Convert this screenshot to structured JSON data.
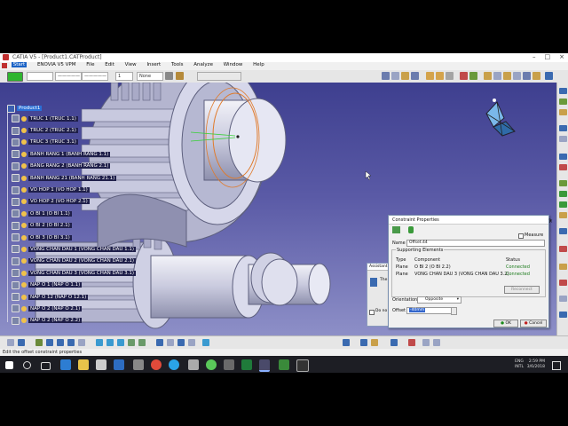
{
  "window": {
    "title": "CATIA V5 - [Product1.CATProduct]",
    "controls": [
      "–",
      "□",
      "×"
    ]
  },
  "menu": {
    "start": "Start",
    "items": [
      "ENOVIA V5 VPM",
      "File",
      "Edit",
      "View",
      "Insert",
      "Tools",
      "Analyze",
      "Window",
      "Help"
    ]
  },
  "toolbar": {
    "field_none": "None",
    "field_line": "—————",
    "field_pts": "1"
  },
  "tree": {
    "root": "Product1",
    "items": [
      "TRUC 1 (TRUC 1.1)",
      "TRUC 2 (TRUC 2.1)",
      "TRUC 3 (TRUC 3.1)",
      "BANH RANG 1 (BANH RANG 1.1)",
      "BANG RANG 2 (BANH RANG 2.1)",
      "BANH RANG 21 (BANH RANG 21.1)",
      "VO HOP 1 (VO HOP 1.1)",
      "VO HOP 2 (VO HOP 2.1)",
      "O BI 1 (O BI 1.1)",
      "O BI 2 (O BI 2.1)",
      "O BI 3 (O BI 3.1)",
      "VONG CHAN DAU 1 (VONG CHAN DAU 1.1)",
      "VONG CHAN DAU 2 (VONG CHAN DAU 2.1)",
      "VONG CHAN DAU 3 (VONG CHAN DAU 3.1)",
      "NAP O 1 (NAP O 1.1)",
      "NAP O 12 (NAP O 12.1)",
      "NAP O 2 (NAP O 2.1)",
      "NAP O 2 (NAP O 2.2)"
    ]
  },
  "dialog": {
    "title": "Constraint Properties",
    "help": "?",
    "close": "×",
    "name_label": "Name",
    "name_value": "Offset.44",
    "measure_label": "Measure",
    "group_title": "Supporting Elements",
    "columns": [
      "Type",
      "Component",
      "Status"
    ],
    "rows": [
      {
        "type": "Plane",
        "component": "O BI 2 (O BI 2.2)",
        "status": "Connected"
      },
      {
        "type": "Plane",
        "component": "VONG CHAN DAU 3 (VONG CHAN DAU 3.2)",
        "status": "Connected"
      }
    ],
    "reconnect": "Reconnect",
    "orientation_label": "Orientation",
    "orientation_value": "Opposite",
    "offset_label": "Offset",
    "offset_value": "-40mm",
    "ok": "OK",
    "cancel": "Cancel"
  },
  "assistant": {
    "title": "Assistant",
    "line": "The",
    "do_not": "Do no"
  },
  "status": {
    "message": "Edit the offset constraint properties"
  },
  "taskbar": {
    "lang_top": "ENG",
    "lang_bottom": "INTL",
    "time": "2:59 PM",
    "date": "3/6/2018"
  },
  "colors": {
    "viewport_top": "#3e3f8f",
    "viewport_bottom": "#8d8fc7",
    "tree_label_bg": "#1f1f4a",
    "selection_orange": "#e07a2a",
    "connected_status": "#1a7a1a"
  }
}
